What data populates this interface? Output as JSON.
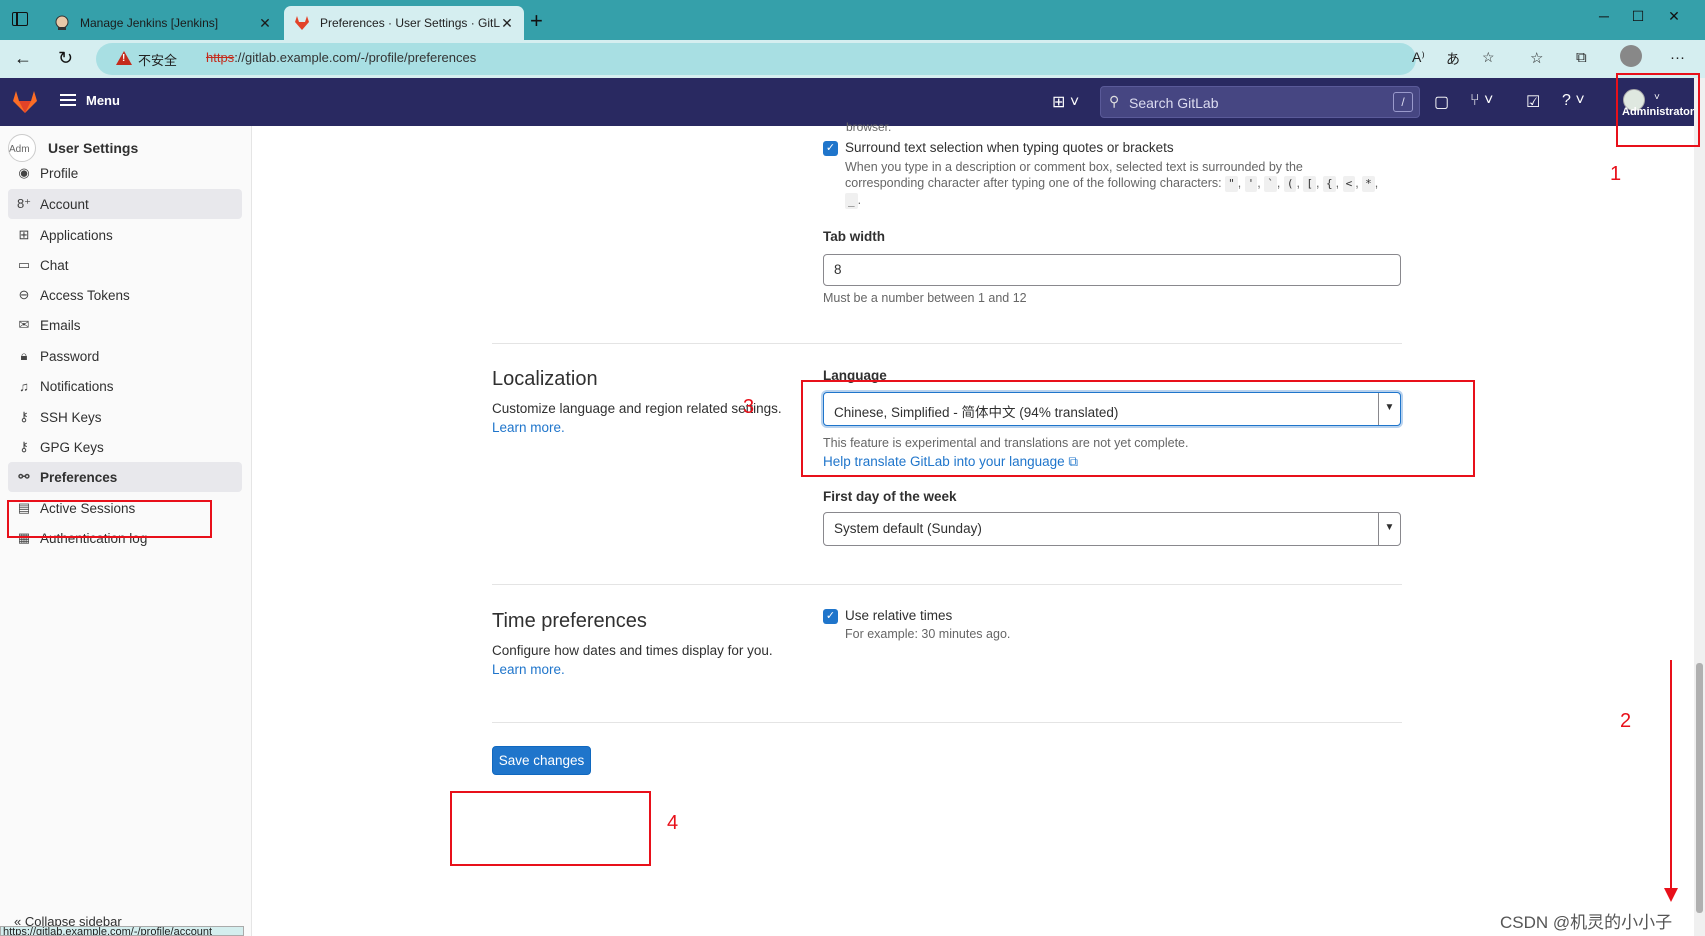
{
  "browser": {
    "tabs": [
      {
        "label": "Manage Jenkins [Jenkins]",
        "active": false
      },
      {
        "label": "Preferences · User Settings · GitL",
        "active": true
      }
    ],
    "insecure_label": "不安全",
    "url_protocol": "https",
    "url_rest": "://gitlab.example.com/-/profile/preferences"
  },
  "header": {
    "menu_label": "Menu",
    "search_placeholder": "Search GitLab",
    "search_shortcut": "/",
    "user_name": "Administrator"
  },
  "sidebar": {
    "title": "User Settings",
    "avatar_alt": "Adm",
    "items": [
      {
        "label": "Profile",
        "icon": "profile-icon"
      },
      {
        "label": "Account",
        "icon": "account-icon"
      },
      {
        "label": "Applications",
        "icon": "applications-icon"
      },
      {
        "label": "Chat",
        "icon": "chat-icon"
      },
      {
        "label": "Access Tokens",
        "icon": "token-icon"
      },
      {
        "label": "Emails",
        "icon": "mail-icon"
      },
      {
        "label": "Password",
        "icon": "lock-icon"
      },
      {
        "label": "Notifications",
        "icon": "bell-icon"
      },
      {
        "label": "SSH Keys",
        "icon": "key-icon"
      },
      {
        "label": "GPG Keys",
        "icon": "key-icon"
      },
      {
        "label": "Preferences",
        "icon": "preferences-icon"
      },
      {
        "label": "Active Sessions",
        "icon": "sessions-icon"
      },
      {
        "label": "Authentication log",
        "icon": "log-icon"
      }
    ],
    "collapse_label": "Collapse sidebar",
    "status_url": "https://gitlab.example.com/-/profile/account"
  },
  "behavior": {
    "cut_text": "browser.",
    "surround_label": "Surround text selection when typing quotes or brackets",
    "surround_help_1": "When you type in a description or comment box, selected text is surrounded by the",
    "surround_help_2": "corresponding character after typing one of the following characters:",
    "surround_chars": [
      "\"",
      "'",
      "`",
      "(",
      "[",
      "{",
      "<",
      "*",
      "_"
    ],
    "tab_width_label": "Tab width",
    "tab_width_value": "8",
    "tab_width_help": "Must be a number between 1 and 12"
  },
  "localization": {
    "title": "Localization",
    "desc": "Customize language and region related settings.",
    "learn_more": "Learn more.",
    "language_label": "Language",
    "language_value": "Chinese, Simplified - 简体中文 (94% translated)",
    "language_help": "This feature is experimental and translations are not yet complete.",
    "help_translate": "Help translate GitLab into your language",
    "first_day_label": "First day of the week",
    "first_day_value": "System default (Sunday)"
  },
  "time_prefs": {
    "title": "Time preferences",
    "desc": "Configure how dates and times display for you.",
    "learn_more": "Learn more.",
    "relative_label": "Use relative times",
    "relative_help": "For example: 30 minutes ago."
  },
  "save_label": "Save changes",
  "annotations": [
    "1",
    "2",
    "3",
    "4"
  ],
  "watermark": "CSDN @机灵的小小子",
  "colors": {
    "header_bg": "#292961",
    "tabbar_bg": "#35a0aa",
    "accent": "#1f75cb",
    "annotation": "#e8101a"
  }
}
